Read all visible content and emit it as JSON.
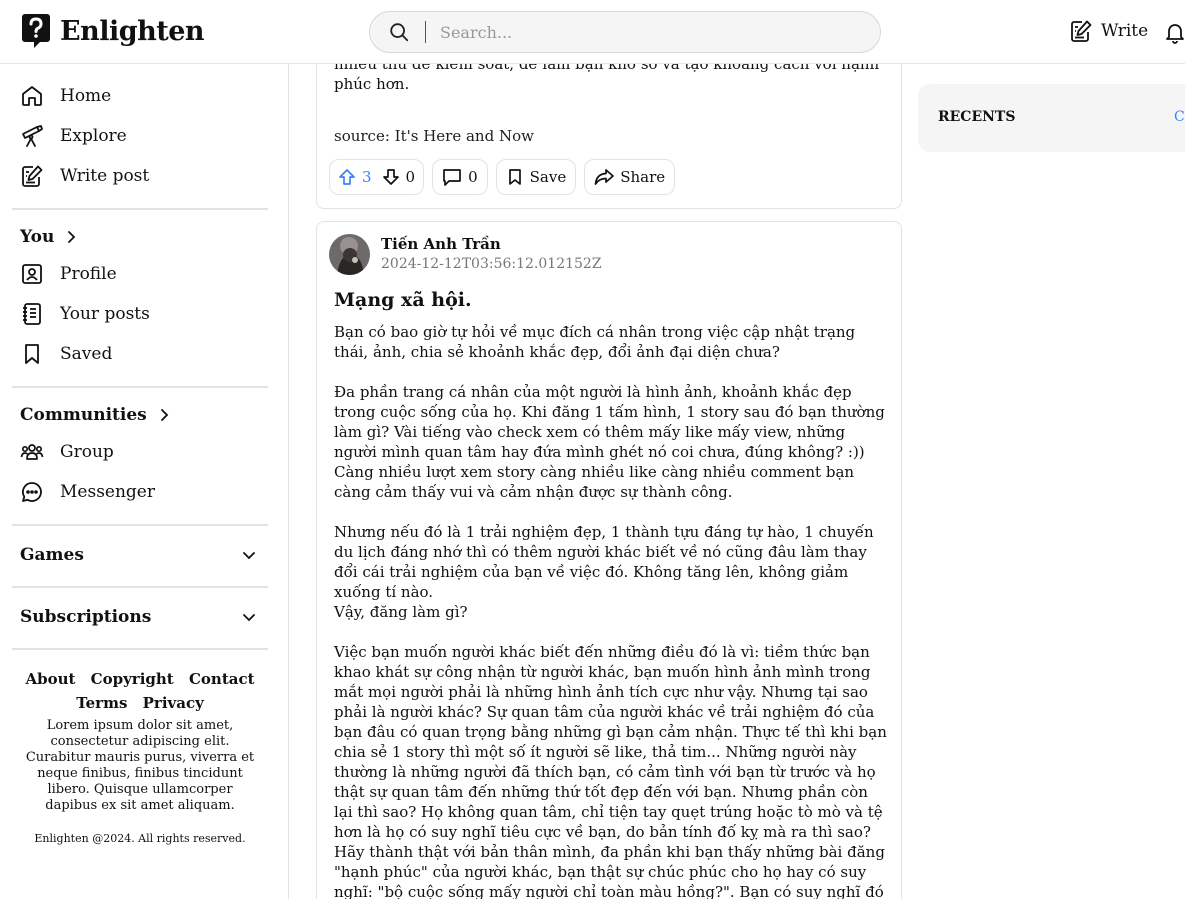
{
  "header": {
    "brand": "Enlighten",
    "search_placeholder": "Search...",
    "write_label": "Write"
  },
  "sidebar": {
    "main": [
      {
        "label": "Home",
        "icon": "home-icon"
      },
      {
        "label": "Explore",
        "icon": "telescope-icon"
      },
      {
        "label": "Write post",
        "icon": "write-post-icon"
      }
    ],
    "you_heading": "You",
    "you_items": [
      {
        "label": "Profile",
        "icon": "profile-icon"
      },
      {
        "label": "Your posts",
        "icon": "posts-icon"
      },
      {
        "label": "Saved",
        "icon": "bookmark-icon"
      }
    ],
    "communities_heading": "Communities",
    "community_items": [
      {
        "label": "Group",
        "icon": "group-icon"
      },
      {
        "label": "Messenger",
        "icon": "messenger-icon"
      }
    ],
    "games_heading": "Games",
    "subscriptions_heading": "Subscriptions",
    "footer_links_row1": [
      "About",
      "Copyright",
      "Contact"
    ],
    "footer_links_row2": [
      "Terms",
      "Privacy"
    ],
    "lorem": "Lorem ipsum dolor sit amet, consectetur adipiscing elit. Curabitur mauris purus, viverra et neque finibus, finibus tincidunt libero. Quisque ullamcorper dapibus ex sit amet aliquam.",
    "copyright": "Enlighten @2024. All rights reserved."
  },
  "post1": {
    "partial_text": "từng ngày. Cái tôi bạn càng lớn thì bạn càng có nhiều thứ để mất và nhiều thứ để kiểm soát, để làm bạn khổ sở và tạo khoảng cách với hạnh phúc hơn.",
    "source": "source: It's Here and Now",
    "upvotes": "3",
    "downvotes": "0",
    "comments": "0",
    "save_label": "Save",
    "share_label": "Share"
  },
  "post2": {
    "author": "Tiến Anh Trần",
    "timestamp": "2024-12-12T03:56:12.012152Z",
    "title": "Mạng xã hội.",
    "paragraphs": [
      "Bạn có bao giờ tự hỏi về mục đích cá nhân trong việc cập nhật trạng thái, ảnh, chia sẻ khoảnh khắc đẹp, đổi ảnh đại diện chưa?",
      "Đa phần trang cá nhân của một người là hình ảnh, khoảnh khắc đẹp trong cuộc sống của họ. Khi đăng 1 tấm hình, 1 story sau đó bạn thường làm gì? Vài tiếng vào check xem có thêm mấy like mấy view, những người mình quan tâm hay đứa mình ghét nó coi chưa, đúng không? :)) Càng nhiều lượt xem story càng nhiều like càng nhiều comment bạn càng cảm thấy vui và cảm nhận được sự thành công.",
      "Nhưng nếu đó là 1 trải nghiệm đẹp, 1 thành tựu đáng tự hào, 1 chuyến du lịch đáng nhớ thì có thêm người khác biết về nó cũng đâu làm thay đổi cái trải nghiệm của bạn về việc đó. Không tăng lên, không giảm xuống tí nào.",
      "Vậy, đăng làm gì?",
      "Việc bạn muốn người khác biết đến những điều đó là vì: tiềm thức bạn khao khát sự công nhận từ người khác, bạn muốn hình ảnh mình trong mắt mọi người phải là những hình ảnh tích cực như vậy. Nhưng tại sao phải là người khác? Sự quan tâm của người khác về trải nghiệm đó của bạn đâu có quan trọng bằng những gì bạn cảm nhận. Thực tế thì khi bạn chia sẻ 1 story thì một số ít người sẽ like, thả tim... Những người này thường là những người đã thích bạn, có cảm tình với bạn từ trước và họ thật sự quan tâm đến những thứ tốt đẹp đến với bạn. Nhưng phần còn lại thì sao? Họ không quan tâm, chỉ tiện tay quẹt trúng hoặc tò mò và tệ hơn là họ có suy nghĩ tiêu cực về bạn, do bản tính đố kỵ mà ra thì sao?",
      "Hãy thành thật với bản thân mình, đa phần khi bạn thấy những bài đăng \"hạnh phúc\" của người khác, bạn thật sự chúc phúc cho họ hay có suy nghĩ: \"bộ cuộc sống mấy người chỉ toàn màu hồng?\". Bạn có suy nghĩ đó thì người khác cũng"
    ]
  },
  "recents": {
    "heading": "RECENTS",
    "clear_label": "C"
  }
}
